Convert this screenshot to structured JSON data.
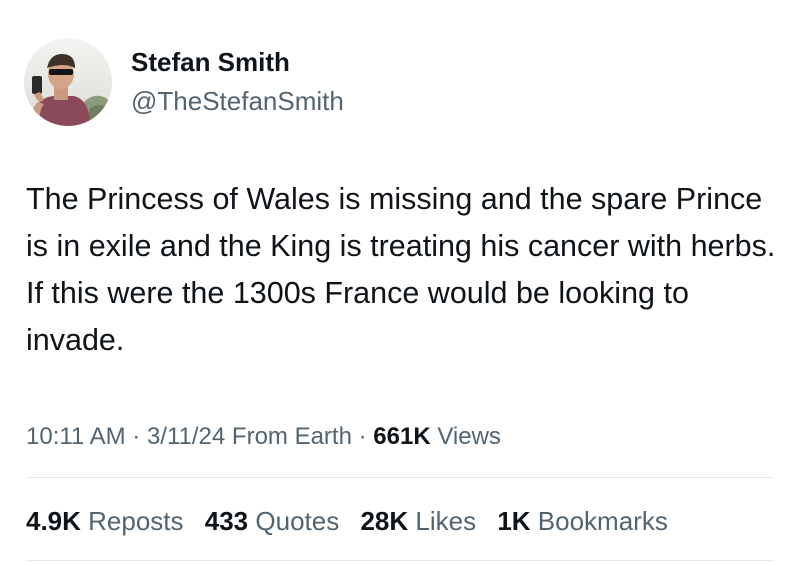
{
  "author": {
    "display_name": "Stefan Smith",
    "handle": "@TheStefanSmith",
    "avatar_icon": "profile-photo"
  },
  "tweet": {
    "text": "The Princess of Wales is missing and the spare Prince is in exile and the King is treating his cancer with herbs. If this were the 1300s France would be looking to invade."
  },
  "meta": {
    "time": "10:11 AM",
    "sep1": " · ",
    "date": "3/11/24",
    "source": " From Earth",
    "sep2": " · ",
    "views_count": "661K",
    "views_label": " Views"
  },
  "stats": {
    "reposts_count": "4.9K",
    "reposts_label": " Reposts",
    "quotes_count": "433",
    "quotes_label": " Quotes",
    "likes_count": "28K",
    "likes_label": " Likes",
    "bookmarks_count": "1K",
    "bookmarks_label": " Bookmarks"
  },
  "colors": {
    "text_primary": "#0f1419",
    "text_secondary": "#536471",
    "divider": "#e6e9eb"
  }
}
